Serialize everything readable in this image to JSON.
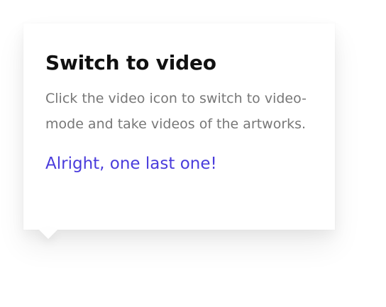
{
  "tooltip": {
    "title": "Switch to video",
    "body": "Click the video icon to switch to video-mode and take videos of the artworks.",
    "cta_label": "Alright, one last one!",
    "accent_color": "#4a3cdc"
  }
}
